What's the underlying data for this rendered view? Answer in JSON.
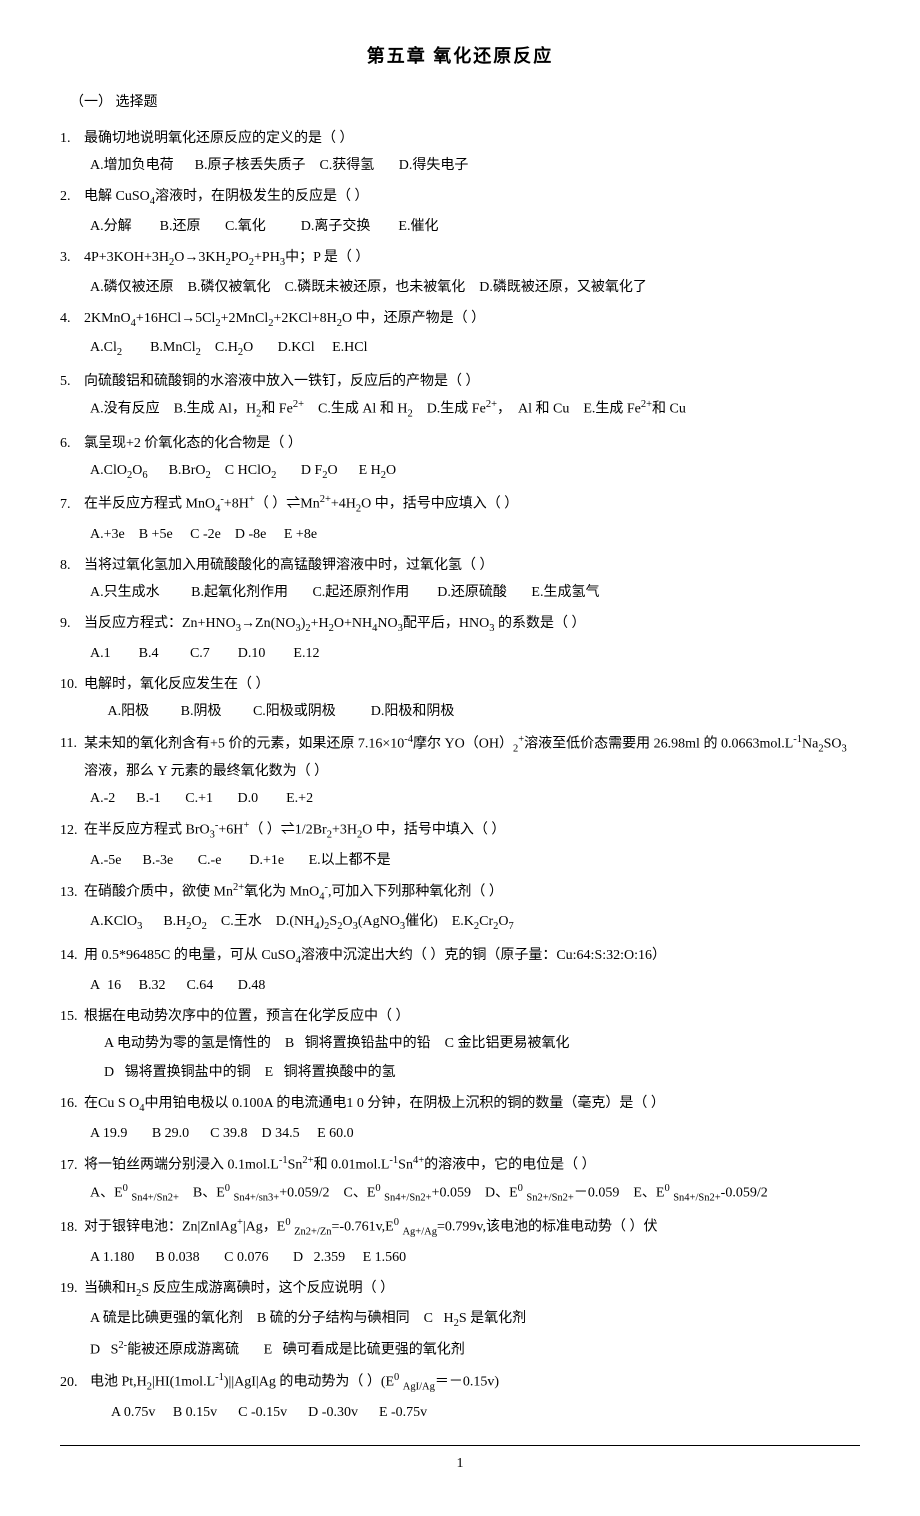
{
  "title": "第五章  氧化还原反应",
  "section": "（一）   选择题",
  "questions": [
    {
      "num": "1.",
      "text": "最确切地说明氧化还原反应的定义的是（  ）",
      "options": "A.增加负电荷      B.原子核丢失质子    C.获得氢       D.得失电子"
    },
    {
      "num": "2.",
      "text": "电解 CuSO₄溶液时，在阴极发生的反应是（  ）",
      "options": "A.分解         B.还原        C.氧化          D.离子交换        E.催化"
    },
    {
      "num": "3.",
      "text": "4P+3KOH+3H₂O→3KH₂PO₂+PH₃中；P 是（  ）",
      "options": "A.磷仅被还原    B.磷仅被氧化    C.磷既未被还原，也未被氧化    D.磷既被还原，又被氧化了"
    },
    {
      "num": "4.",
      "text": "2KMnO₄+16HCl→5Cl₂+2MnCl₂+2KCl+8H₂O 中，还原产物是（  ）",
      "options": "A.Cl₂        B.MnCl₂    C.H₂O       D.KCl     E.HCl"
    },
    {
      "num": "5.",
      "text": "向硫酸铝和硫酸铜的水溶液中放入一铁钉，反应后的产物是（  ）",
      "options": "A.没有反应    B.生成 Al，H₂和 Fe²⁺    C.生成 Al 和 H₂    D.生成 Fe²⁺，  Al 和 Cu    E.生成 Fe²⁺和 Cu"
    },
    {
      "num": "6.",
      "text": "氯呈现+2 价氧化态的化合物是（  ）",
      "options": "A.ClO₂O₆      B.BrO₂    C HClO₂       D F₂O      E H₂O"
    },
    {
      "num": "7.",
      "text": "在半反应方程式 MnO₄⁻+8H⁺（  ）⇌Mn²⁺+4H₂O 中，括号中应填入（  ）",
      "options": "A.+3e    B +5e     C  -2e    D -8e     E  +8e"
    },
    {
      "num": "8.",
      "text": "当将过氧化氢加入用硫酸酸化的高锰酸钾溶液中时，过氧化氢（  ）",
      "options": "A.只生成水         B.起氧化剂作用       C.起还原剂作用        D.还原硫酸       E.生成氢气"
    },
    {
      "num": "9.",
      "text": "当反应方程式：Zn+HNO₃→Zn(NO₃)₂+H₂O+NH₄NO₃配平后，HNO₃ 的系数是（  ）",
      "options": "A.1        B.4         C.7        D.10        E.12"
    },
    {
      "num": "10.",
      "text": "电解时，氧化反应发生在（  ）",
      "options": "A.阳极         B.阴极         C.阳极或阴极          D.阳极和阴极"
    },
    {
      "num": "11.",
      "text": "某未知的氧化剂含有+5 价的元素，如果还原 7.16×10⁻⁴摩尔 YO（OH）₂⁺溶液至低价态需要用 26.98ml 的 0.0663mol.L⁻¹Na₂SO₃溶液，那么 Y 元素的最终氧化数为（  ）",
      "options": "A.-2      B.-1       C.+1       D.0        E.+2"
    },
    {
      "num": "12.",
      "text": "在半反应方程式 BrO₃⁻+6H⁺（  ）⇌1/2Br₂+3H₂O 中，括号中填入（  ）",
      "options": "A.-5e      B.-3e       C.-e        D.+1e       E.以上都不是"
    },
    {
      "num": "13.",
      "text": "在硝酸介质中，欲使 Mn²⁺氧化为 MnO₄⁻,可加入下列那种氧化剂（  ）",
      "options": "A.KClO₃      B.H₂O₂    C.王水    D.(NH₄)₂S₂O₃(AgNO₃催化)    E.K₂Cr₂O₇"
    },
    {
      "num": "14.",
      "text": "用 0.5*96485C 的电量，可从 CuSO₄溶液中沉淀出大约（  ）克的铜（原子量：Cu:64:S:32:O:16）",
      "options": "A  16     B.32      C.64       D.48"
    },
    {
      "num": "15.",
      "text": "根据在电动势次序中的位置，预言在化学反应中（  ）",
      "options_multiline": [
        "A  电动势为零的氢是惰性的    B   铜将置换铅盐中的铅    C  金比铝更易被氧化",
        "D   锡将置换铜盐中的铜    E   铜将置换酸中的氢"
      ]
    },
    {
      "num": "16.",
      "text": "在Cu S O₄中用铂电极以 0.100A 的电流通电1 0 分钟，在阴极上沉积的铜的数量（毫克）是（  ）",
      "options": "A  19.9       B  29.0      C  39.8    D  34.5     E  60.0"
    },
    {
      "num": "17.",
      "text": "将一铂丝两端分别浸入 0.1mol.L⁻¹Sn²⁺和 0.01mol.L⁻¹Sn⁴⁺的溶液中，它的电位是（  ）",
      "options": "A、E⁰ Sn4+/Sn2+    B、E⁰ Sn4+/sn3++0.059/2    C、E⁰ Sn4+/Sn2++0.059    D、E⁰ Sn2+/Sn2+－0.059    E、E⁰ Sn4+/Sn2+-0.059/2"
    },
    {
      "num": "18.",
      "text": "对于银锌电池：Zn|Zn‖Ag⁺|Ag，E⁰ Zn2+/Zn=-0.761v,E⁰ Ag+/Ag=0.799v,该电池的标准电动势（  ）伏",
      "options": "A  1.180      B  0.038       C  0.076       D   2.359     E  1.560"
    },
    {
      "num": "19.",
      "text": "当碘和H₂S 反应生成游离碘时，这个反应说明（  ）",
      "options_multiline": [
        "A  硫是比碘更强的氧化剂    B  硫的分子结构与碘相同    C   H₂S 是氧化剂",
        "D   S²⁻能被还原成游离硫       E   碘可看成是比硫更强的氧化剂"
      ]
    },
    {
      "num": "20.",
      "text": "电池 Pt,H₂|HI(1mol.L⁻¹)||AgI|Ag 的电动势为（  ）(E⁰ AgI/Ag＝－0.15v)",
      "options": "A  0.75v     B  0.15v      C  -0.15v      D  -0.30v      E  -0.75v"
    }
  ],
  "footer": "1"
}
